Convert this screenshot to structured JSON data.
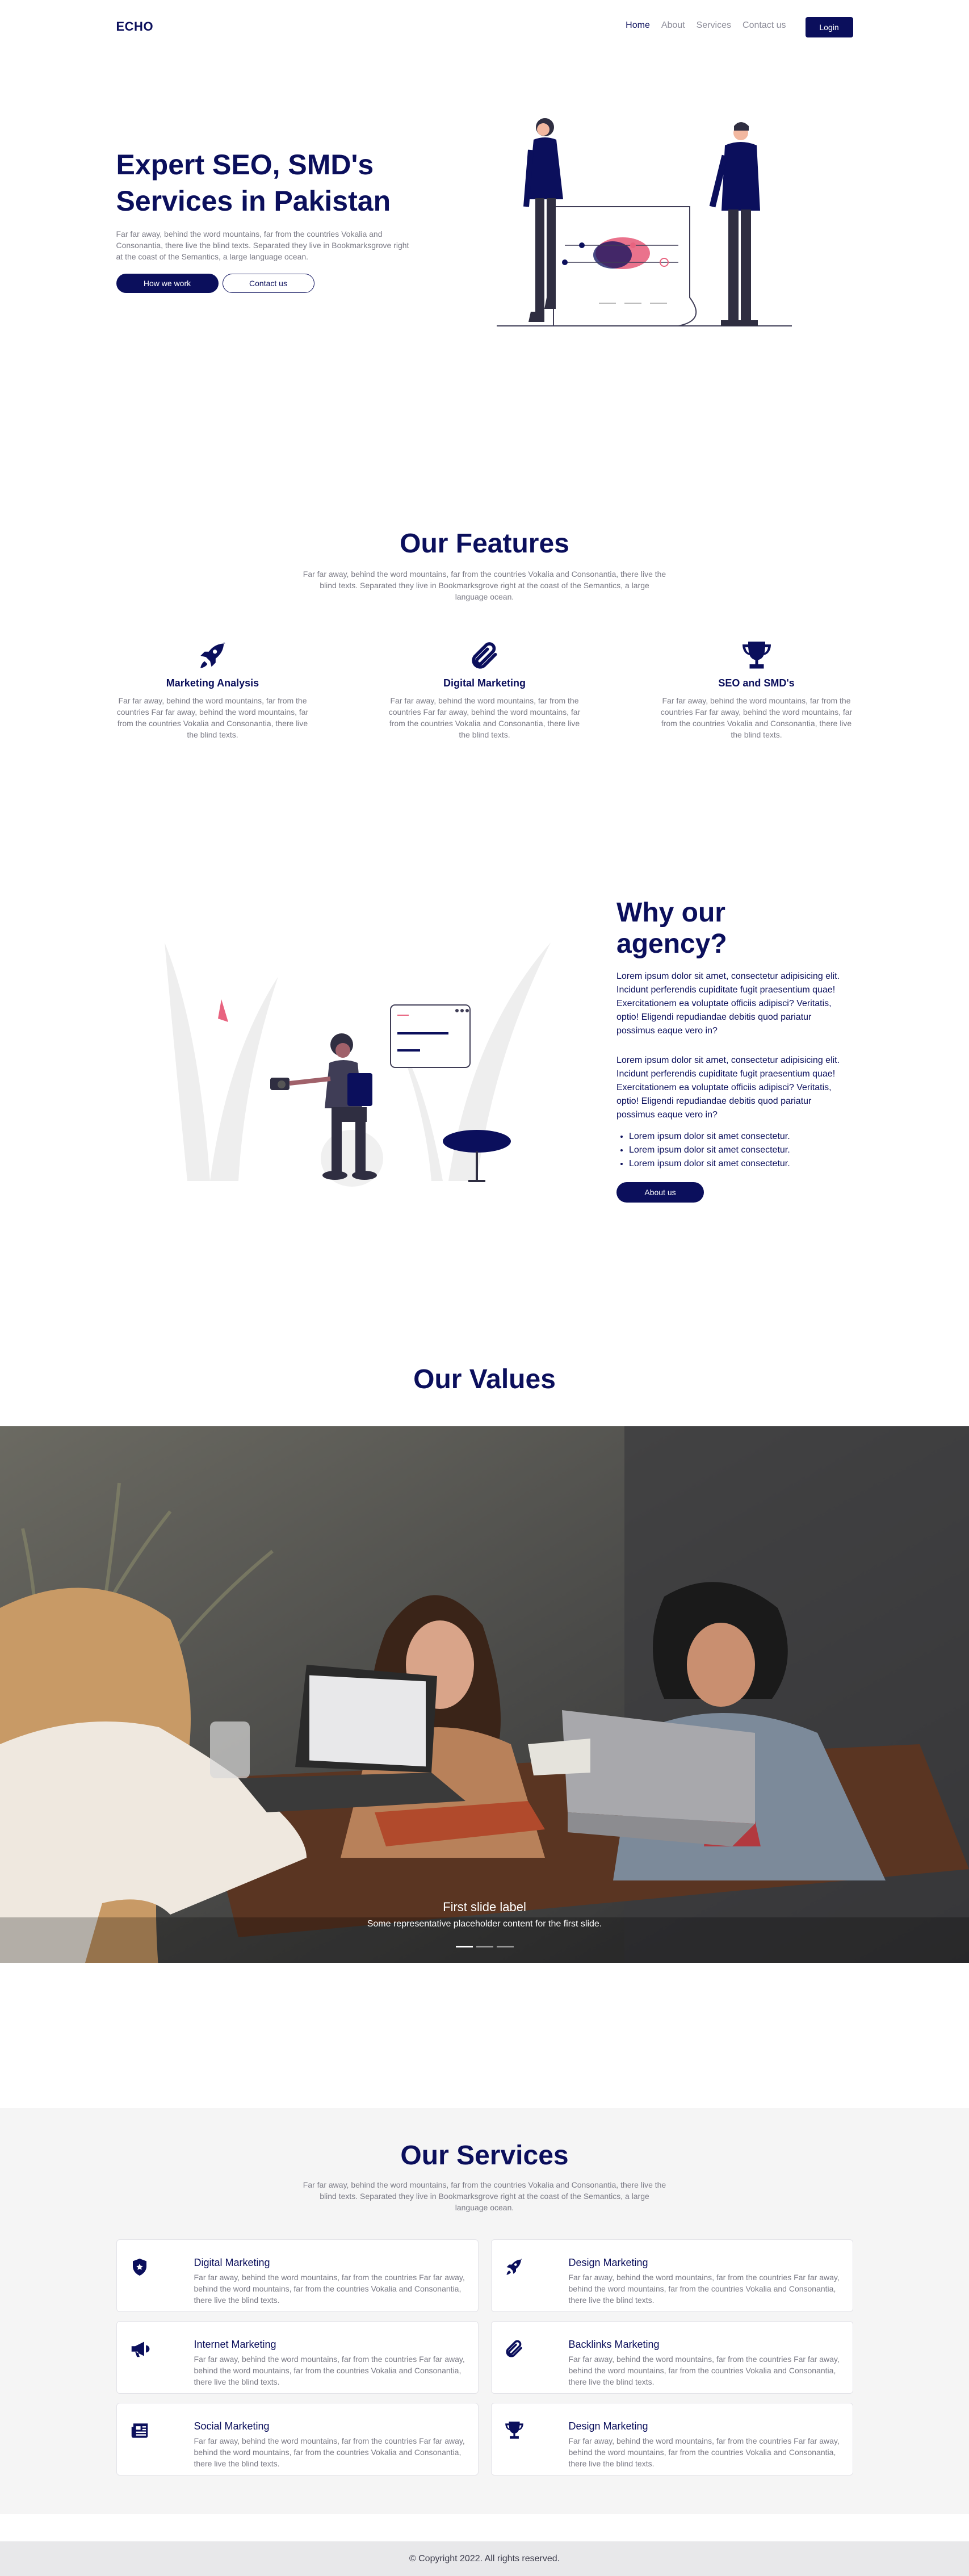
{
  "nav": {
    "brand": "ECHO",
    "links": [
      "Home",
      "About",
      "Services",
      "Contact us"
    ],
    "login": "Login"
  },
  "hero": {
    "title": "Expert SEO, SMD's Services in Pakistan",
    "text": "Far far away, behind the word mountains, far from the countries Vokalia and Consonantia, there live the blind texts. Separated they live in Bookmarksgrove right at the coast of the Semantics, a large language ocean.",
    "btn_primary": "How we work",
    "btn_secondary": "Contact us"
  },
  "features": {
    "title": "Our Features",
    "subtitle": "Far far away, behind the word mountains, far from the countries Vokalia and Consonantia, there live the blind texts. Separated they live in Bookmarksgrove right at the coast of the Semantics, a large language ocean.",
    "items": [
      {
        "icon": "rocket-icon",
        "title": "Marketing Analysis",
        "text": "Far far away, behind the word mountains, far from the countries Far far away, behind the word mountains, far from the countries Vokalia and Consonantia, there live the blind texts."
      },
      {
        "icon": "paperclip-icon",
        "title": "Digital Marketing",
        "text": "Far far away, behind the word mountains, far from the countries Far far away, behind the word mountains, far from the countries Vokalia and Consonantia, there live the blind texts."
      },
      {
        "icon": "trophy-icon",
        "title": "SEO and SMD's",
        "text": "Far far away, behind the word mountains, far from the countries Far far away, behind the word mountains, far from the countries Vokalia and Consonantia, there live the blind texts."
      }
    ]
  },
  "why": {
    "title": "Why our agency?",
    "p1": "Lorem ipsum dolor sit amet, consectetur adipisicing elit. Incidunt perferendis cupiditate fugit praesentium quae! Exercitationem ea voluptate officiis adipisci? Veritatis, optio! Eligendi repudiandae debitis quod pariatur possimus eaque vero in?",
    "p2": "Lorem ipsum dolor sit amet, consectetur adipisicing elit. Incidunt perferendis cupiditate fugit praesentium quae! Exercitationem ea voluptate officiis adipisci? Veritatis, optio! Eligendi repudiandae debitis quod pariatur possimus eaque vero in?",
    "bullets": [
      "Lorem ipsum dolor sit amet consectetur.",
      "Lorem ipsum dolor sit amet consectetur.",
      "Lorem ipsum dolor sit amet consectetur."
    ],
    "button": "About us"
  },
  "values": {
    "title": "Our Values",
    "slide_label": "First slide label",
    "slide_text": "Some representative placeholder content for the first slide.",
    "slide_count": 3,
    "active_slide": 1
  },
  "services": {
    "title": "Our Services",
    "subtitle": "Far far away, behind the word mountains, far from the countries Vokalia and Consonantia, there live the blind texts. Separated they live in Bookmarksgrove right at the coast of the Semantics, a large language ocean.",
    "items": [
      {
        "icon": "shield-icon",
        "title": "Digital Marketing",
        "text": "Far far away, behind the word mountains, far from the countries Far far away, behind the word mountains, far from the countries Vokalia and Consonantia, there live the blind texts."
      },
      {
        "icon": "rocket-icon",
        "title": "Design Marketing",
        "text": "Far far away, behind the word mountains, far from the countries Far far away, behind the word mountains, far from the countries Vokalia and Consonantia, there live the blind texts."
      },
      {
        "icon": "megaphone-icon",
        "title": "Internet Marketing",
        "text": "Far far away, behind the word mountains, far from the countries Far far away, behind the word mountains, far from the countries Vokalia and Consonantia, there live the blind texts."
      },
      {
        "icon": "paperclip-icon",
        "title": "Backlinks Marketing",
        "text": "Far far away, behind the word mountains, far from the countries Far far away, behind the word mountains, far from the countries Vokalia and Consonantia, there live the blind texts."
      },
      {
        "icon": "newspaper-icon",
        "title": "Social Marketing",
        "text": "Far far away, behind the word mountains, far from the countries Far far away, behind the word mountains, far from the countries Vokalia and Consonantia, there live the blind texts."
      },
      {
        "icon": "trophy-icon",
        "title": "Design Marketing",
        "text": "Far far away, behind the word mountains, far from the countries Far far away, behind the word mountains, far from the countries Vokalia and Consonantia, there live the blind texts."
      }
    ]
  },
  "footer": {
    "copyright": "© Copyright 2022. All rights reserved."
  },
  "colors": {
    "primary": "#0b0f5c",
    "muted": "#7a7a85",
    "accent_pink": "#e8637f",
    "services_bg": "#f5f5f5",
    "footer_bg": "#e8e8ea"
  }
}
